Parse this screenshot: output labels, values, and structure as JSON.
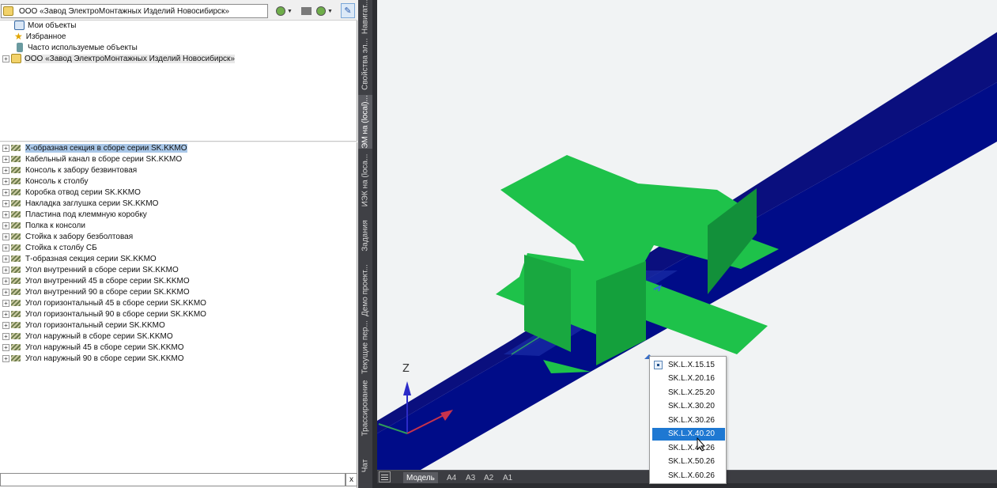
{
  "toolbar": {
    "org_selector_value": "ООО «Завод ЭлектроМонтажных Изделий Новосибирск»"
  },
  "top_tree": [
    {
      "label": "Мои объекты",
      "icon": "my-objects-icon"
    },
    {
      "label": "Избранное",
      "icon": "star-icon"
    },
    {
      "label": "Часто используемые объекты",
      "icon": "frequent-icon"
    },
    {
      "label": "ООО «Завод ЭлектроМонтажных Изделий Новосибирск»",
      "icon": "organization-icon"
    }
  ],
  "catalog_items": [
    "X-образная секция в сборе серии SK.KKMO",
    "Кабельный канал в сборе серии SK.KKMO",
    "Консоль к забору безвинтовая",
    "Консоль к столбу",
    "Коробка отвод серии SK.KKMO",
    "Накладка заглушка серии SK.KKMO",
    "Пластина под клеммную коробку",
    "Полка к консоли",
    "Стойка к забору безболтовая",
    "Стойка к столбу СБ",
    "Т-образная секция серии SK.KKMO",
    "Угол внутренний в сборе серии SK.KKMO",
    "Угол внутренний 45 в сборе серии SK.KKMO",
    "Угол внутренний 90 в сборе серии SK.KKMO",
    "Угол горизонтальный 45 в сборе серии SK.KKMO",
    "Угол горизонтальный 90 в сборе серии SK.KKMO",
    "Угол горизонтальный серии SK.KKMO",
    "Угол наружный в сборе серии SK.KKMO",
    "Угол наружный 45 в сборе серии SK.KKMO",
    "Угол наружный 90 в сборе серии SK.KKMO"
  ],
  "selected_item_index": 0,
  "search": {
    "value": "",
    "clear_label": "x"
  },
  "side_tabs": [
    {
      "label": "Навигат...",
      "active": false
    },
    {
      "label": "Свойства эл...",
      "active": false
    },
    {
      "label": "ЭМ на (local)...",
      "active": true
    },
    {
      "label": "ИЭК на (loca...",
      "active": false
    },
    {
      "label": "Задания",
      "active": false
    },
    {
      "label": "Демо проект...",
      "active": false
    },
    {
      "label": "Текущие пер...",
      "active": false
    },
    {
      "label": "Трассирование",
      "active": false
    },
    {
      "label": "Чат",
      "active": false
    }
  ],
  "layout_tabs": [
    {
      "label": "Модель",
      "active": true
    },
    {
      "label": "A4",
      "active": false
    },
    {
      "label": "A3",
      "active": false
    },
    {
      "label": "A2",
      "active": false
    },
    {
      "label": "A1",
      "active": false
    }
  ],
  "axis_label": "Z",
  "size_options": [
    {
      "label": "SK.L.X.15.15",
      "checked": true,
      "highlighted": false
    },
    {
      "label": "SK.L.X.20.16",
      "checked": false,
      "highlighted": false
    },
    {
      "label": "SK.L.X.25.20",
      "checked": false,
      "highlighted": false
    },
    {
      "label": "SK.L.X.30.20",
      "checked": false,
      "highlighted": false
    },
    {
      "label": "SK.L.X.30.26",
      "checked": false,
      "highlighted": false
    },
    {
      "label": "SK.L.X.40.20",
      "checked": false,
      "highlighted": true
    },
    {
      "label": "SK.L.X.40.26",
      "checked": false,
      "highlighted": false
    },
    {
      "label": "SK.L.X.50.26",
      "checked": false,
      "highlighted": false
    },
    {
      "label": "SK.L.X.60.26",
      "checked": false,
      "highlighted": false
    }
  ],
  "colors": {
    "tray_blue": "#0a0f7e",
    "section_green": "#1ec24a",
    "section_dark_green": "#12903a",
    "highlight_blue": "#1e78d2"
  }
}
